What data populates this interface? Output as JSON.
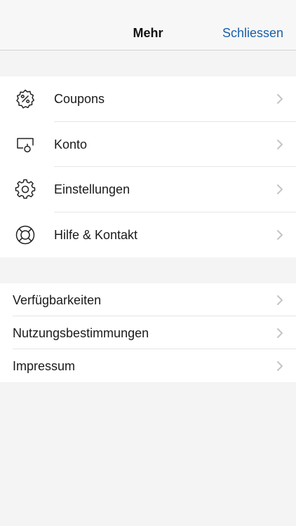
{
  "navbar": {
    "title": "Mehr",
    "close_label": "Schliessen",
    "close_color": "#1b5fa8"
  },
  "menu_main": [
    {
      "label": "Coupons",
      "icon": "coupon-percent-icon"
    },
    {
      "label": "Konto",
      "icon": "account-icon"
    },
    {
      "label": "Einstellungen",
      "icon": "gear-icon"
    },
    {
      "label": "Hilfe & Kontakt",
      "icon": "lifebuoy-icon"
    }
  ],
  "menu_secondary": [
    {
      "label": "Verfügbarkeiten"
    },
    {
      "label": "Nutzungsbestimmungen"
    },
    {
      "label": "Impressum"
    }
  ]
}
